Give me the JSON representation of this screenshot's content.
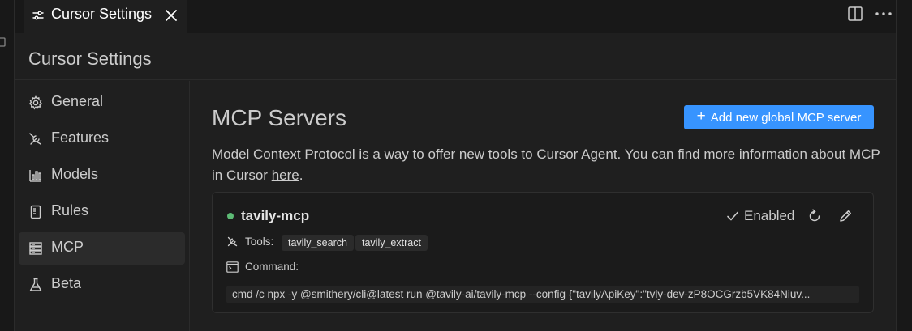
{
  "tab": {
    "title": "Cursor Settings",
    "icon": "settings-sliders-icon",
    "close_icon": "close-icon"
  },
  "toolbar": {
    "split_icon": "split-editor-icon",
    "more_icon": "more-actions-icon"
  },
  "panel": {
    "title": "Cursor Settings"
  },
  "sidebar": {
    "items": [
      {
        "label": "General",
        "icon": "gear-icon"
      },
      {
        "label": "Features",
        "icon": "tools-icon"
      },
      {
        "label": "Models",
        "icon": "bar-chart-icon"
      },
      {
        "label": "Rules",
        "icon": "book-icon"
      },
      {
        "label": "MCP",
        "icon": "server-icon"
      },
      {
        "label": "Beta",
        "icon": "flask-icon"
      }
    ],
    "active": "MCP"
  },
  "main": {
    "title": "MCP Servers",
    "add_button": {
      "label": "Add new global MCP server",
      "icon": "plus-icon"
    },
    "description_text": "Model Context Protocol is a way to offer new tools to Cursor Agent. You can find more information about MCP in Cursor ",
    "description_link": "here",
    "description_end": "."
  },
  "server": {
    "name": "tavily-mcp",
    "status_color": "#5dbb75",
    "enabled_label": "Enabled",
    "tools_label": "Tools:",
    "tools": [
      "tavily_search",
      "tavily_extract"
    ],
    "command_label": "Command:",
    "command": "cmd /c npx -y @smithery/cli@latest run @tavily-ai/tavily-mcp --config {\"tavilyApiKey\":\"tvly-dev-zP8OCGrzb5VK84Niuv..."
  },
  "colors": {
    "background": "#1f1f1f",
    "accent": "#3794ff",
    "active_item": "#2b2b2b"
  }
}
